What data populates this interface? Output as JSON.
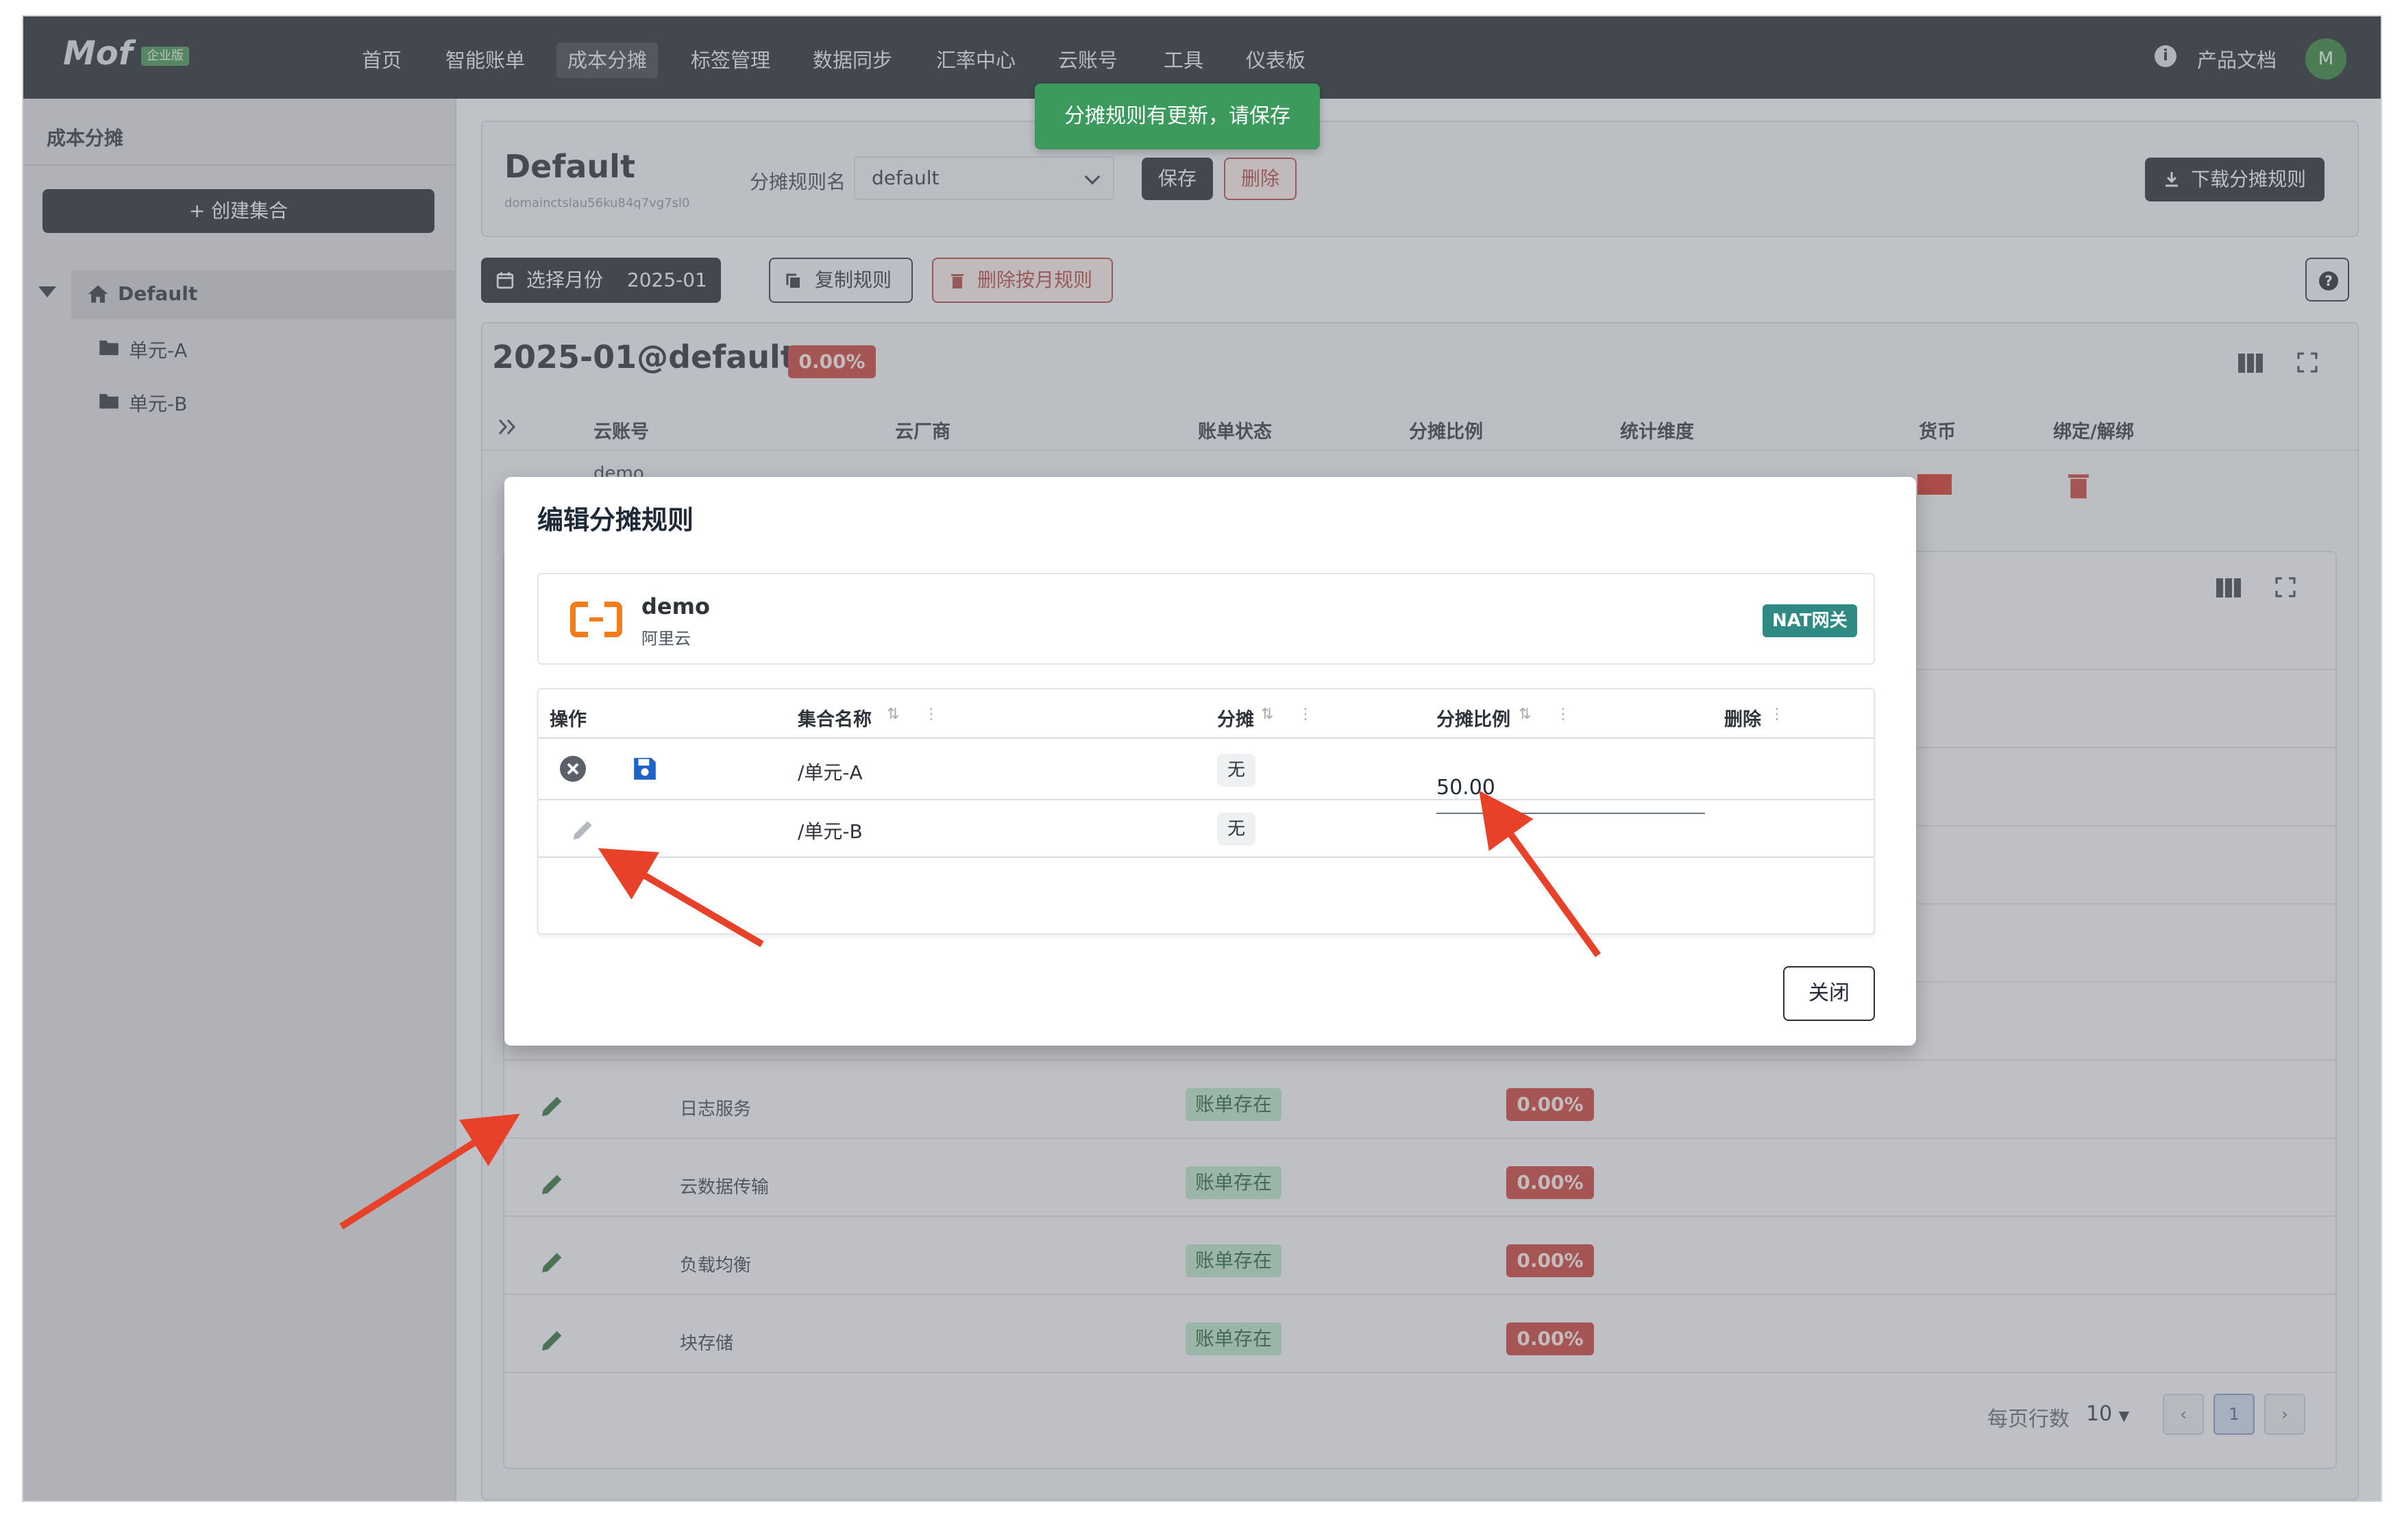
{
  "app": {
    "logo": "Mof",
    "edition": "企业版"
  },
  "nav": {
    "items": [
      "首页",
      "智能账单",
      "成本分摊",
      "标签管理",
      "数据同步",
      "汇率中心",
      "云账号",
      "工具",
      "仪表板"
    ],
    "active": "成本分摊",
    "docs": "产品文档",
    "avatar": "M"
  },
  "sidebar": {
    "title": "成本分摊",
    "create_button": "+ 创建集合",
    "tree": {
      "root": "Default",
      "children": [
        "单元-A",
        "单元-B"
      ]
    }
  },
  "header": {
    "title": "Default",
    "id": "domainctslau56ku84q7vg7sl0",
    "rule_name_label": "分摊规则名",
    "rule_name_value": "default",
    "save": "保存",
    "delete": "删除",
    "download": "下载分摊规则",
    "toast": "分摊规则有更新，请保存"
  },
  "toolbar": {
    "select_month_label": "选择月份",
    "month": "2025-01",
    "copy_rule": "复制规则",
    "delete_month_rule": "删除按月规则"
  },
  "table": {
    "title": "2025-01@default",
    "percent": "0.00%",
    "columns": [
      "云账号",
      "云厂商",
      "账单状态",
      "分摊比例",
      "统计维度",
      "货币",
      "绑定/解绑"
    ],
    "partial_account": "demo"
  },
  "service_rows": [
    {
      "name": "日志服务",
      "status": "账单存在",
      "ratio": "0.00%"
    },
    {
      "name": "云数据传输",
      "status": "账单存在",
      "ratio": "0.00%"
    },
    {
      "name": "负载均衡",
      "status": "账单存在",
      "ratio": "0.00%"
    },
    {
      "name": "块存储",
      "status": "账单存在",
      "ratio": "0.00%"
    }
  ],
  "pagination": {
    "rows_per_page_label": "每页行数",
    "rows_per_page": "10",
    "page": "1"
  },
  "modal": {
    "title": "编辑分摊规则",
    "account_name": "demo",
    "provider": "阿里云",
    "service_badge": "NAT网关",
    "columns": [
      "操作",
      "集合名称",
      "分摊",
      "分摊比例",
      "删除"
    ],
    "rows": [
      {
        "name": "/单元-A",
        "alloc": "无",
        "ratio": "50.00"
      },
      {
        "name": "/单元-B",
        "alloc": "无",
        "ratio": ""
      }
    ],
    "close": "关闭"
  },
  "colors": {
    "nav_bg": "#1e2228",
    "accent_green": "#3c9a5d",
    "danger": "#c43a33",
    "annotation_arrow": "#e8412a",
    "aliyun_orange": "#f07c1b"
  }
}
